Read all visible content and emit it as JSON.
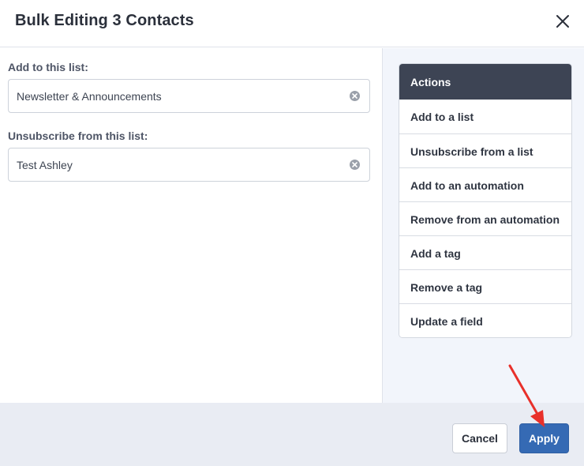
{
  "modal": {
    "title": "Bulk Editing 3 Contacts"
  },
  "fields": [
    {
      "label": "Add to this list:",
      "value": "Newsletter & Announcements"
    },
    {
      "label": "Unsubscribe from this list:",
      "value": "Test Ashley"
    }
  ],
  "actions": {
    "header": "Actions",
    "items": [
      "Add to a list",
      "Unsubscribe from a list",
      "Add to an automation",
      "Remove from an automation",
      "Add a tag",
      "Remove a tag",
      "Update a field"
    ]
  },
  "footer": {
    "cancel_label": "Cancel",
    "apply_label": "Apply"
  },
  "colors": {
    "primary": "#356ab4",
    "actions_header": "#3d4454",
    "annotation_arrow": "#e8302a"
  },
  "icons": {
    "close": "close-icon",
    "clear": "clear-circle-x-icon",
    "arrow": "red-arrow-annotation"
  }
}
